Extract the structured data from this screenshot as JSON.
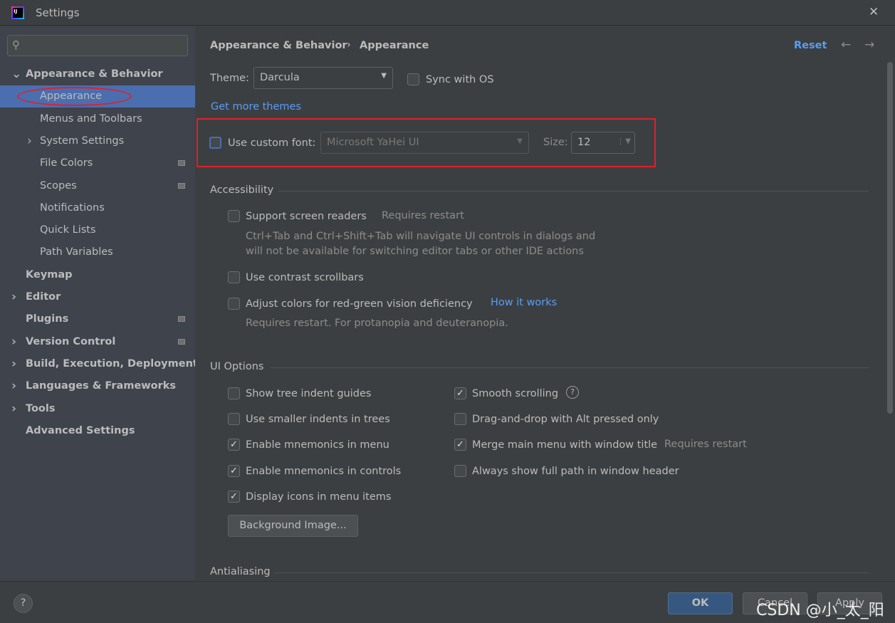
{
  "window": {
    "title": "Settings",
    "close": "✕"
  },
  "sidebar": {
    "search_placeholder": "",
    "items": [
      {
        "label": "Appearance & Behavior",
        "expanded": true
      },
      {
        "label": "Appearance",
        "selected": true
      },
      {
        "label": "Menus and Toolbars"
      },
      {
        "label": "System Settings"
      },
      {
        "label": "File Colors"
      },
      {
        "label": "Scopes"
      },
      {
        "label": "Notifications"
      },
      {
        "label": "Quick Lists"
      },
      {
        "label": "Path Variables"
      },
      {
        "label": "Keymap"
      },
      {
        "label": "Editor"
      },
      {
        "label": "Plugins"
      },
      {
        "label": "Version Control"
      },
      {
        "label": "Build, Execution, Deployment"
      },
      {
        "label": "Languages & Frameworks"
      },
      {
        "label": "Tools"
      },
      {
        "label": "Advanced Settings"
      }
    ]
  },
  "header": {
    "breadcrumb_parent": "Appearance & Behavior",
    "breadcrumb_sep": "›",
    "breadcrumb_current": "Appearance",
    "reset": "Reset",
    "back": "←",
    "forward": "→"
  },
  "theme": {
    "label": "Theme:",
    "value": "Darcula",
    "sync_label": "Sync with OS",
    "sync_checked": false,
    "more_themes": "Get more themes"
  },
  "font": {
    "label": "Use custom font:",
    "checked": false,
    "value": "Microsoft YaHei UI",
    "size_label": "Size:",
    "size_value": "12"
  },
  "accessibility": {
    "title": "Accessibility",
    "screen_readers": "Support screen readers",
    "screen_readers_hint": "Requires restart",
    "screen_readers_desc1": "Ctrl+Tab and Ctrl+Shift+Tab will navigate UI controls in dialogs and",
    "screen_readers_desc2": "will not be available for switching editor tabs or other IDE actions",
    "contrast": "Use contrast scrollbars",
    "colors": "Adjust colors for red-green vision deficiency",
    "how_it_works": "How it works",
    "colors_desc": "Requires restart. For protanopia and deuteranopia."
  },
  "ui_options": {
    "title": "UI Options",
    "left": [
      {
        "label": "Show tree indent guides",
        "checked": false
      },
      {
        "label": "Use smaller indents in trees",
        "checked": false
      },
      {
        "label": "Enable mnemonics in menu",
        "checked": true
      },
      {
        "label": "Enable mnemonics in controls",
        "checked": true
      },
      {
        "label": "Display icons in menu items",
        "checked": true
      }
    ],
    "right": [
      {
        "label": "Smooth scrolling",
        "checked": true
      },
      {
        "label": "Drag-and-drop with Alt pressed only",
        "checked": false
      },
      {
        "label": "Merge main menu with window title",
        "checked": true
      },
      {
        "label": "Always show full path in window header",
        "checked": false
      }
    ],
    "merge_hint": "Requires restart",
    "help": "?",
    "background_image": "Background Image..."
  },
  "antialiasing": {
    "title": "Antialiasing"
  },
  "footer": {
    "help": "?",
    "ok": "OK",
    "cancel": "Cancel",
    "apply": "Apply"
  },
  "watermark": "CSDN @小_太_阳",
  "colors": {
    "accent": "#4b6eaf",
    "link": "#589df6",
    "highlight": "#e0202a"
  }
}
